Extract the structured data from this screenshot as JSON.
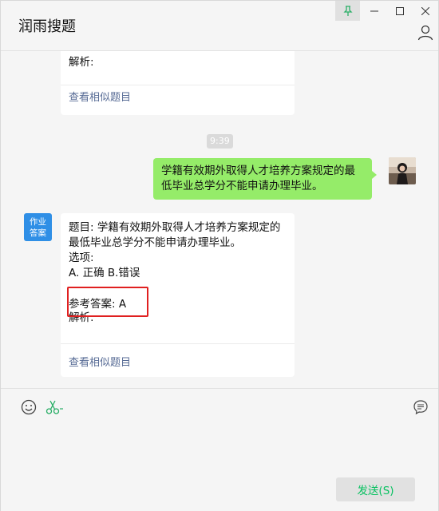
{
  "window": {
    "title": "润雨搜题"
  },
  "chat": {
    "card_top": {
      "analysis_label": "解析:",
      "similar_link": "查看相似题目"
    },
    "timestamp": "9:39",
    "my_message": "学籍有效期外取得人才培养方案规定的最低毕业总学分不能申请办理毕业。",
    "bot_avatar": {
      "line1": "作业",
      "line2": "答案"
    },
    "card_answer": {
      "question": "题目: 学籍有效期外取得人才培养方案规定的最低毕业总学分不能申请办理毕业。",
      "options_label": "选项:",
      "options": "A. 正确 B.错误",
      "reference_answer": "参考答案:  A",
      "analysis_label": "解析:",
      "similar_link": "查看相似题目"
    }
  },
  "input": {
    "send_label": "发送(S)"
  },
  "colors": {
    "bubble_me": "#95ec69",
    "link": "#576b95",
    "send_text": "#07c160",
    "highlight": "#e02020"
  }
}
